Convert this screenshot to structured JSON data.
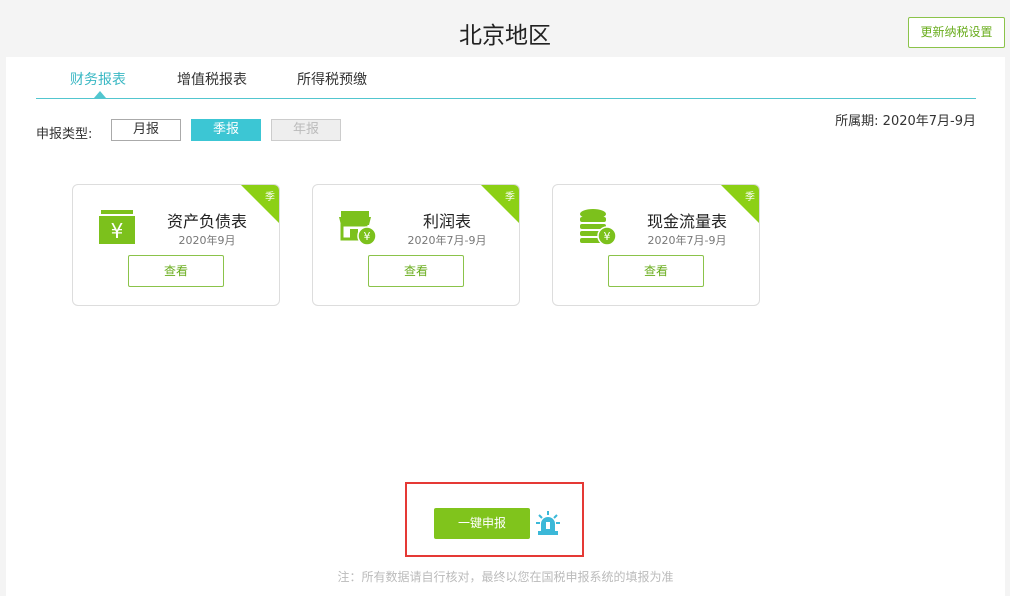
{
  "header": {
    "title": "北京地区",
    "update_button": "更新纳税设置"
  },
  "tabs": [
    {
      "label": "财务报表",
      "active": true
    },
    {
      "label": "增值税报表",
      "active": false
    },
    {
      "label": "所得税预缴",
      "active": false
    }
  ],
  "filter": {
    "label": "申报类型:",
    "options": [
      {
        "label": "月报",
        "state": "normal"
      },
      {
        "label": "季报",
        "state": "selected"
      },
      {
        "label": "年报",
        "state": "disabled"
      }
    ],
    "period": "所属期: 2020年7月-9月"
  },
  "cards": [
    {
      "title": "资产负债表",
      "date": "2020年9月",
      "badge": "季",
      "view": "查看",
      "icon": "money-bag-icon"
    },
    {
      "title": "利润表",
      "date": "2020年7月-9月",
      "badge": "季",
      "view": "查看",
      "icon": "shop-yuan-icon"
    },
    {
      "title": "现金流量表",
      "date": "2020年7月-9月",
      "badge": "季",
      "view": "查看",
      "icon": "coin-stack-icon"
    }
  ],
  "actions": {
    "submit": "一键申报",
    "note": "注：所有数据请自行核对，最终以您在国税申报系统的填报为准"
  },
  "colors": {
    "accent_teal": "#3cc6d4",
    "accent_green": "#80c41c",
    "highlight_red": "#e53935"
  }
}
